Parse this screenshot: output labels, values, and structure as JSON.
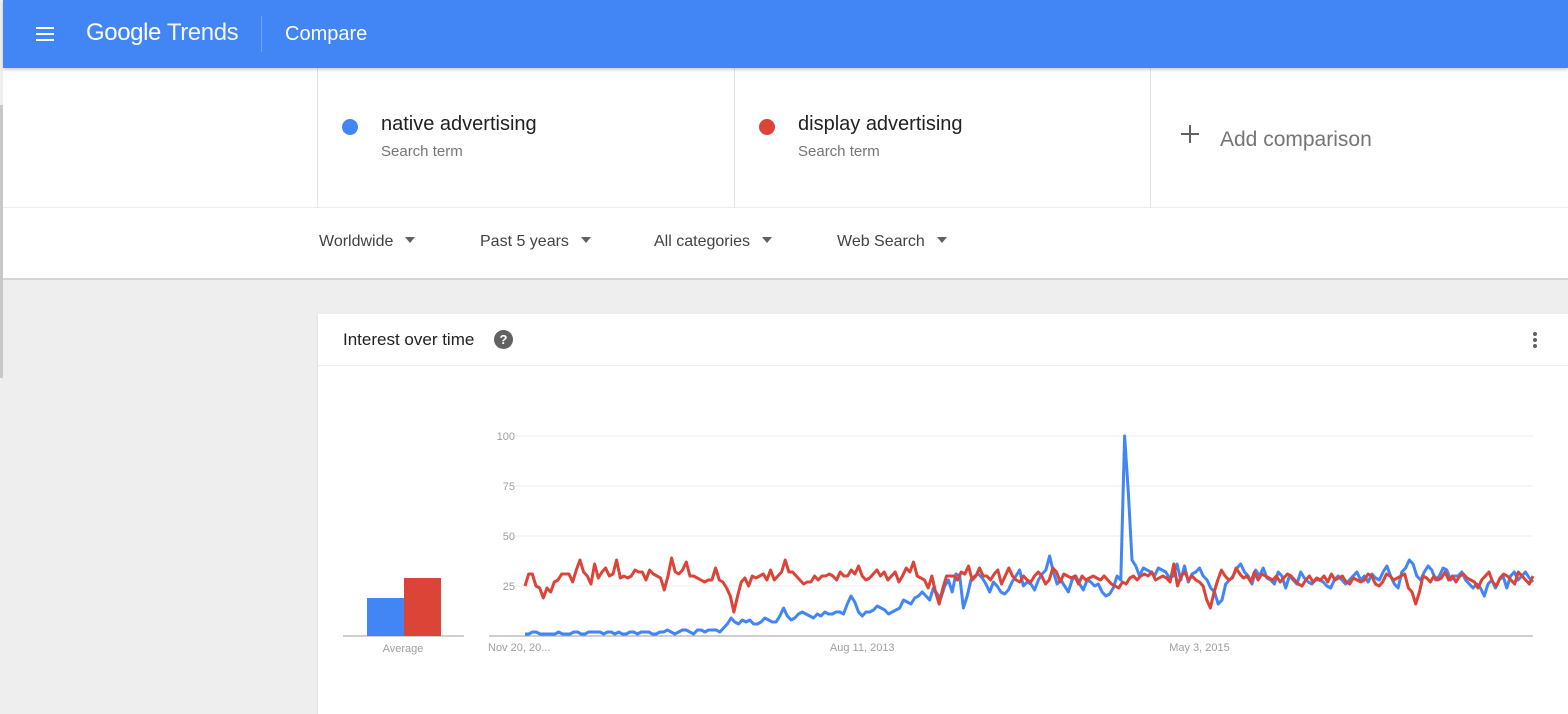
{
  "appbar": {
    "menu_icon": "hamburger-menu-icon",
    "logo_google": "Google",
    "logo_trends": "Trends",
    "page_title": "Compare"
  },
  "terms": [
    {
      "name": "native advertising",
      "type": "Search term",
      "color": "#4285f4"
    },
    {
      "name": "display advertising",
      "type": "Search term",
      "color": "#db4437"
    }
  ],
  "add_comparison": {
    "icon": "plus-icon",
    "label": "Add comparison"
  },
  "filters": [
    {
      "label": "Worldwide",
      "icon": "caret-down-icon"
    },
    {
      "label": "Past 5 years",
      "icon": "caret-down-icon"
    },
    {
      "label": "All categories",
      "icon": "caret-down-icon"
    },
    {
      "label": "Web Search",
      "icon": "caret-down-icon"
    }
  ],
  "card": {
    "title": "Interest over time",
    "help_icon": "?",
    "more_icon": "more-vert-icon"
  },
  "chart_data": {
    "type": "line",
    "title": "Interest over time",
    "xlabel": "",
    "ylabel": "",
    "ylim": [
      0,
      100
    ],
    "yticks": [
      25,
      50,
      75,
      100
    ],
    "xtick_labels": [
      {
        "label": "Nov 20, 20...",
        "index": 0
      },
      {
        "label": "Aug 11, 2013",
        "index": 90
      },
      {
        "label": "May 3, 2015",
        "index": 180
      }
    ],
    "grid": true,
    "legend": "none",
    "x_start": "Nov 20, 2011",
    "x_step": "weekly",
    "series": [
      {
        "name": "native advertising",
        "color": "#4285f4",
        "values": [
          1,
          1,
          2,
          2,
          1,
          1,
          1,
          1,
          1,
          2,
          1,
          1,
          1,
          2,
          2,
          1,
          1,
          2,
          2,
          2,
          2,
          1,
          2,
          2,
          1,
          2,
          1,
          1,
          2,
          2,
          1,
          2,
          2,
          2,
          1,
          1,
          2,
          2,
          3,
          2,
          1,
          2,
          3,
          3,
          2,
          1,
          3,
          3,
          2,
          3,
          3,
          3,
          2,
          4,
          6,
          9,
          7,
          6,
          8,
          7,
          8,
          6,
          6,
          7,
          9,
          8,
          7,
          7,
          10,
          14,
          10,
          8,
          9,
          11,
          12,
          11,
          10,
          9,
          11,
          10,
          12,
          11,
          11,
          12,
          12,
          11,
          16,
          20,
          17,
          12,
          10,
          12,
          12,
          13,
          15,
          14,
          13,
          11,
          12,
          13,
          14,
          18,
          17,
          16,
          19,
          20,
          22,
          20,
          18,
          24,
          21,
          19,
          25,
          28,
          22,
          31,
          30,
          14,
          20,
          28,
          30,
          31,
          29,
          26,
          22,
          27,
          25,
          22,
          21,
          23,
          27,
          30,
          33,
          25,
          27,
          26,
          23,
          28,
          31,
          33,
          40,
          32,
          26,
          28,
          25,
          22,
          28,
          30,
          26,
          23,
          28,
          27,
          25,
          26,
          22,
          20,
          21,
          24,
          30,
          28,
          100,
          72,
          38,
          35,
          30,
          34,
          33,
          32,
          30,
          34,
          33,
          32,
          29,
          30,
          36,
          28,
          35,
          27,
          31,
          32,
          34,
          30,
          28,
          24,
          22,
          16,
          18,
          26,
          28,
          30,
          34,
          36,
          32,
          30,
          26,
          33,
          30,
          34,
          29,
          28,
          26,
          32,
          30,
          24,
          30,
          28,
          26,
          32,
          29,
          27,
          26,
          28,
          28,
          27,
          25,
          24,
          28,
          30,
          28,
          26,
          28,
          30,
          32,
          28,
          30,
          27,
          31,
          29,
          28,
          32,
          35,
          30,
          26,
          24,
          32,
          34,
          38,
          36,
          30,
          28,
          32,
          35,
          33,
          28,
          30,
          34,
          33,
          28,
          30,
          30,
          32,
          28,
          26,
          24,
          26,
          24,
          20,
          26,
          28,
          24,
          28,
          30,
          24,
          30,
          32,
          28,
          30,
          32,
          29,
          27
        ]
      },
      {
        "name": "display advertising",
        "color": "#db4437",
        "values": [
          25,
          31,
          31,
          25,
          24,
          19,
          24,
          22,
          27,
          28,
          31,
          31,
          31,
          27,
          33,
          38,
          32,
          30,
          26,
          36,
          29,
          32,
          34,
          30,
          31,
          38,
          29,
          30,
          29,
          30,
          33,
          32,
          32,
          28,
          33,
          31,
          30,
          29,
          23,
          30,
          39,
          32,
          31,
          33,
          37,
          30,
          30,
          29,
          28,
          27,
          28,
          28,
          34,
          28,
          27,
          24,
          20,
          12,
          20,
          27,
          29,
          25,
          30,
          29,
          30,
          31,
          28,
          33,
          28,
          30,
          32,
          38,
          32,
          32,
          30,
          28,
          26,
          27,
          27,
          30,
          28,
          30,
          30,
          31,
          30,
          28,
          32,
          30,
          30,
          33,
          31,
          35,
          30,
          28,
          29,
          31,
          33,
          30,
          32,
          28,
          30,
          32,
          27,
          30,
          34,
          32,
          37,
          30,
          29,
          28,
          24,
          30,
          22,
          16,
          24,
          30,
          30,
          30,
          28,
          32,
          31,
          35,
          28,
          30,
          34,
          30,
          30,
          28,
          31,
          33,
          26,
          30,
          34,
          30,
          28,
          27,
          30,
          28,
          27,
          30,
          32,
          30,
          26,
          28,
          34,
          32,
          27,
          31,
          30,
          29,
          30,
          26,
          30,
          28,
          29,
          30,
          29,
          28,
          30,
          28,
          26,
          25,
          24,
          27,
          26,
          29,
          30,
          28,
          30,
          31,
          30,
          32,
          28,
          29,
          30,
          29,
          27,
          36,
          25,
          30,
          32,
          28,
          30,
          28,
          27,
          25,
          18,
          14,
          22,
          28,
          33,
          30,
          28,
          29,
          34,
          31,
          29,
          30,
          27,
          32,
          28,
          31,
          30,
          29,
          28,
          30,
          27,
          29,
          31,
          30,
          28,
          26,
          25,
          28,
          30,
          27,
          29,
          28,
          30,
          27,
          31,
          28,
          29,
          30,
          27,
          26,
          29,
          28,
          27,
          28,
          31,
          30,
          26,
          25,
          27,
          31,
          30,
          28,
          29,
          30,
          31,
          24,
          22,
          16,
          22,
          30,
          29,
          27,
          30,
          28,
          29,
          32,
          28,
          30,
          27,
          30,
          31,
          29,
          28,
          27,
          24,
          28,
          30,
          32,
          27,
          25,
          29,
          31,
          30,
          28,
          26,
          32,
          30,
          28,
          26,
          30
        ]
      }
    ],
    "averages": {
      "label": "Average",
      "values": [
        {
          "name": "native advertising",
          "value": 19,
          "color": "#4285f4"
        },
        {
          "name": "display advertising",
          "value": 29,
          "color": "#db4437"
        }
      ]
    }
  }
}
